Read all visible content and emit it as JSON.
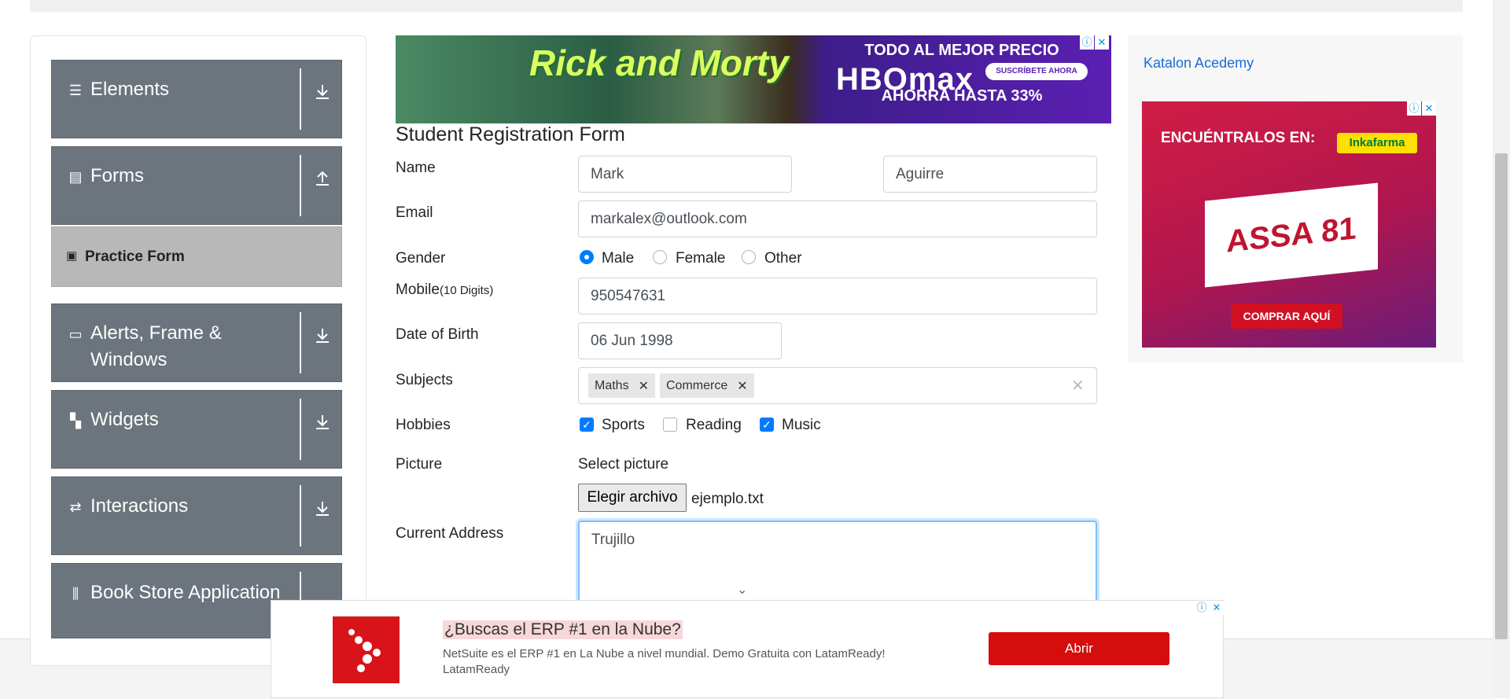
{
  "sidebar": {
    "groups": [
      {
        "label": "Elements",
        "icon": "menu-icon",
        "arrow": "download-icon"
      },
      {
        "label": "Forms",
        "icon": "document-icon",
        "arrow": "upload-icon"
      },
      {
        "label": "Alerts, Frame & Windows",
        "icon": "window-icon",
        "arrow": "download-icon"
      },
      {
        "label": "Widgets",
        "icon": "widgets-icon",
        "arrow": "download-icon"
      },
      {
        "label": "Interactions",
        "icon": "interactions-icon",
        "arrow": "download-icon"
      },
      {
        "label": "Book Store Application",
        "icon": "books-icon",
        "arrow": "download-icon"
      }
    ],
    "active_item": "Practice Form"
  },
  "ads": {
    "top": {
      "brand_left": "Rick and Morty",
      "line1": "TODO AL MEJOR PRECIO",
      "brand": "HBOmax",
      "cta": "SUSCRÍBETE AHORA",
      "line2": "AHORRA HASTA 33%"
    },
    "right": {
      "link": "Katalon Acedemy",
      "headline": "ENCUÉNTRALOS EN:",
      "store": "Inkafarma",
      "product": "ASSA 81",
      "cta": "COMPRAR AQUÍ"
    },
    "bottom": {
      "headline": "¿Buscas el ERP #1 en la Nube?",
      "body": "NetSuite es el ERP #1 en La Nube a nivel mundial. Demo Gratuita con LatamReady! LatamReady",
      "button": "Abrir"
    }
  },
  "form": {
    "title": "Student Registration Form",
    "name_label": "Name",
    "first_name": "Mark",
    "last_name": "Aguirre",
    "email_label": "Email",
    "email": "markalex@outlook.com",
    "gender_label": "Gender",
    "gender_options": [
      "Male",
      "Female",
      "Other"
    ],
    "gender_selected": "Male",
    "mobile_label": "Mobile",
    "mobile_hint": "(10 Digits)",
    "mobile": "950547631",
    "dob_label": "Date of Birth",
    "dob": "06 Jun 1998",
    "subjects_label": "Subjects",
    "subjects": [
      "Maths",
      "Commerce"
    ],
    "hobbies_label": "Hobbies",
    "hobbies": [
      {
        "label": "Sports",
        "checked": true
      },
      {
        "label": "Reading",
        "checked": false
      },
      {
        "label": "Music",
        "checked": true
      }
    ],
    "picture_label": "Picture",
    "picture_hint": "Select picture",
    "file_button": "Elegir archivo",
    "file_name": "ejemplo.txt",
    "address_label": "Current Address",
    "address": "Trujillo"
  }
}
